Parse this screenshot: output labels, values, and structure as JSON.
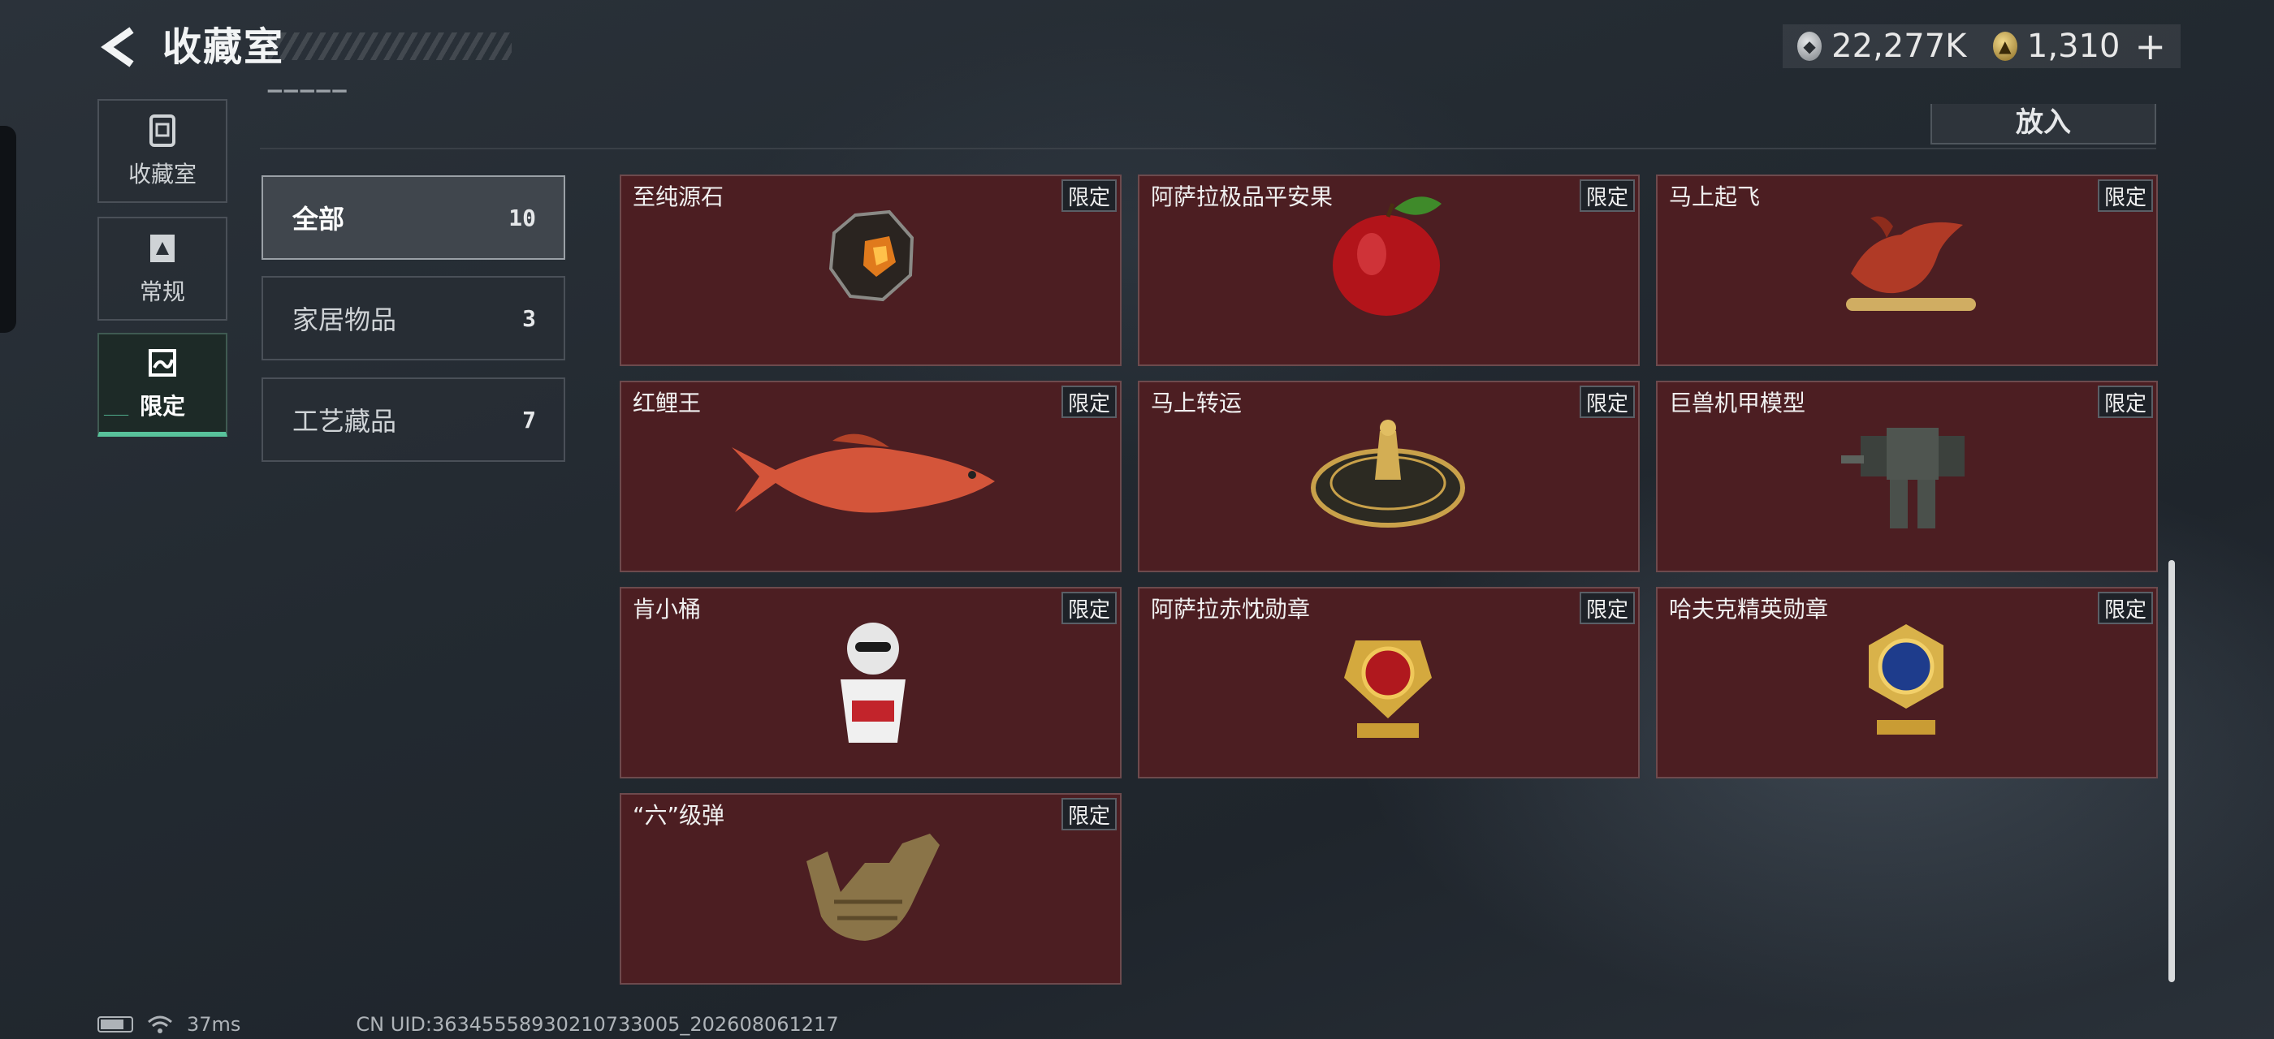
{
  "header": {
    "title": "收藏室",
    "currency_silver": "22,277K",
    "currency_gold": "1,310",
    "add_label": "+"
  },
  "left_nav": [
    {
      "label": "收藏室",
      "icon": "collection-icon"
    },
    {
      "label": "常规",
      "icon": "regular-icon"
    },
    {
      "label": "限定",
      "icon": "limited-icon",
      "active": true
    }
  ],
  "toolbar": {
    "put_label": "放入"
  },
  "categories": [
    {
      "label": "全部",
      "count": "10",
      "active": true
    },
    {
      "label": "家居物品",
      "count": "3"
    },
    {
      "label": "工艺藏品",
      "count": "7"
    }
  ],
  "items": [
    {
      "name": "至纯源石",
      "tag": "限定",
      "icon": "crystal-stone-icon"
    },
    {
      "name": "阿萨拉极品平安果",
      "tag": "限定",
      "icon": "apple-icon"
    },
    {
      "name": "马上起飞",
      "tag": "限定",
      "icon": "flying-horse-icon"
    },
    {
      "name": "红鲤王",
      "tag": "限定",
      "icon": "carp-fish-icon"
    },
    {
      "name": "马上转运",
      "tag": "限定",
      "icon": "spinning-coin-icon"
    },
    {
      "name": "巨兽机甲模型",
      "tag": "限定",
      "icon": "mech-model-icon"
    },
    {
      "name": "肯小桶",
      "tag": "限定",
      "icon": "kfc-bucket-figure-icon"
    },
    {
      "name": "阿萨拉赤忱勋章",
      "tag": "限定",
      "icon": "red-medal-icon"
    },
    {
      "name": "哈夫克精英勋章",
      "tag": "限定",
      "icon": "blue-medal-icon"
    },
    {
      "name": "“六”级弹",
      "tag": "限定",
      "icon": "shaka-hand-icon"
    }
  ],
  "status_bar": {
    "ping": "37ms",
    "uid": "CN UID:36345558930210733005_202608061217"
  },
  "colors": {
    "card_bg": "#4c1e22",
    "accent_green": "#58c29b",
    "background": "#232a31"
  }
}
